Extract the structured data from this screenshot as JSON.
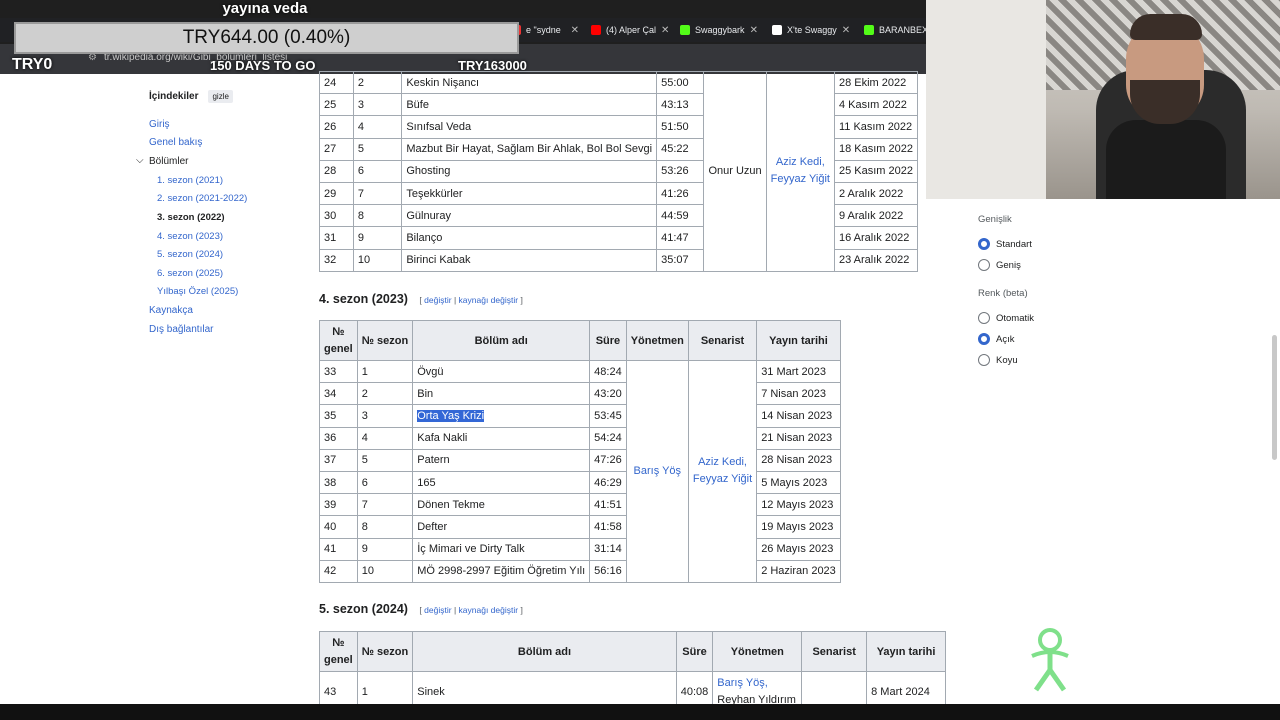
{
  "overlay": {
    "title": "yayına veda",
    "ticker": "TRY644.00 (0.40%)",
    "try0": "TRY0",
    "days": "150 DAYS TO GO",
    "try2": "TRY163000"
  },
  "browser": {
    "url": "tr.wikipedia.org/wiki/Gibi_bölümleri_listesi",
    "tabs": [
      {
        "label": "e \"sydne",
        "color": "#e33"
      },
      {
        "label": "(4) Alper Çal",
        "color": "#ff0000"
      },
      {
        "label": "Swaggybark",
        "color": "#53fc18"
      },
      {
        "label": "X'te Swaggy",
        "color": "#ffffff"
      },
      {
        "label": "BARANBEX",
        "color": "#53fc18"
      }
    ]
  },
  "toc": {
    "title": "İçindekiler",
    "hide": "gizle",
    "items": [
      "Giriş",
      "Genel bakış",
      "Bölümler",
      "1. sezon (2021)",
      "2. sezon (2021-2022)",
      "3. sezon (2022)",
      "4. sezon (2023)",
      "5. sezon (2024)",
      "6. sezon (2025)",
      "Yılbaşı Özel (2025)",
      "Kaynakça",
      "Dış bağlantılar"
    ]
  },
  "season3": {
    "rows": [
      [
        "24",
        "2",
        "Keskin Nişancı",
        "55:00",
        "28 Ekim 2022"
      ],
      [
        "25",
        "3",
        "Büfe",
        "43:13",
        "4 Kasım 2022"
      ],
      [
        "26",
        "4",
        "Sınıfsal Veda",
        "51:50",
        "11 Kasım 2022"
      ],
      [
        "27",
        "5",
        "Mazbut Bir Hayat, Sağlam Bir Ahlak, Bol Bol Sevgi",
        "45:22",
        "18 Kasım 2022"
      ],
      [
        "28",
        "6",
        "Ghosting",
        "53:26",
        "25 Kasım 2022"
      ],
      [
        "29",
        "7",
        "Teşekkürler",
        "41:26",
        "2 Aralık 2022"
      ],
      [
        "30",
        "8",
        "Gülnuray",
        "44:59",
        "9 Aralık 2022"
      ],
      [
        "31",
        "9",
        "Bilanço",
        "41:47",
        "16 Aralık 2022"
      ],
      [
        "32",
        "10",
        "Birinci Kabak",
        "35:07",
        "23 Aralık 2022"
      ]
    ],
    "director": "Onur Uzun",
    "writer1": "Aziz Kedi,",
    "writer2": "Feyyaz Yiğit"
  },
  "season4": {
    "heading": "4. sezon (2023)",
    "edit": "değiştir",
    "edit_sep": "|",
    "edit_src": "kaynağı değiştir",
    "headers": {
      "no1": "№",
      "no2": "genel",
      "season": "№ sezon",
      "title": "Bölüm adı",
      "dur": "Süre",
      "dir": "Yönetmen",
      "writer": "Senarist",
      "date": "Yayın tarihi"
    },
    "rows": [
      [
        "33",
        "1",
        "Övgü",
        "48:24",
        "31 Mart 2023"
      ],
      [
        "34",
        "2",
        "Bin",
        "43:20",
        "7 Nisan 2023"
      ],
      [
        "35",
        "3",
        "Orta Yaş Krizi",
        "53:45",
        "14 Nisan 2023"
      ],
      [
        "36",
        "4",
        "Kafa Nakli",
        "54:24",
        "21 Nisan 2023"
      ],
      [
        "37",
        "5",
        "Patern",
        "47:26",
        "28 Nisan 2023"
      ],
      [
        "38",
        "6",
        "165",
        "46:29",
        "5 Mayıs 2023"
      ],
      [
        "39",
        "7",
        "Dönen Tekme",
        "41:51",
        "12 Mayıs 2023"
      ],
      [
        "40",
        "8",
        "Defter",
        "41:58",
        "19 Mayıs 2023"
      ],
      [
        "41",
        "9",
        "İç Mimari ve Dirty Talk",
        "31:14",
        "26 Mayıs 2023"
      ],
      [
        "42",
        "10",
        "MÖ 2998-2997 Eğitim Öğretim Yılı",
        "56:16",
        "2 Haziran 2023"
      ]
    ],
    "director": "Barış Yöş",
    "writer1": "Aziz Kedi,",
    "writer2": "Feyyaz Yiğit"
  },
  "season5": {
    "heading": "5. sezon (2024)",
    "row": [
      "43",
      "1",
      "Sinek",
      "40:08",
      "8 Mart 2024"
    ],
    "director1": "Barış Yöş,",
    "director2": "Reyhan Yıldırım"
  },
  "settings": {
    "width_title": "Genişlik",
    "width_opts": [
      "Standart",
      "Geniş"
    ],
    "color_title": "Renk (beta)",
    "color_opts": [
      "Otomatik",
      "Açık",
      "Koyu"
    ]
  }
}
